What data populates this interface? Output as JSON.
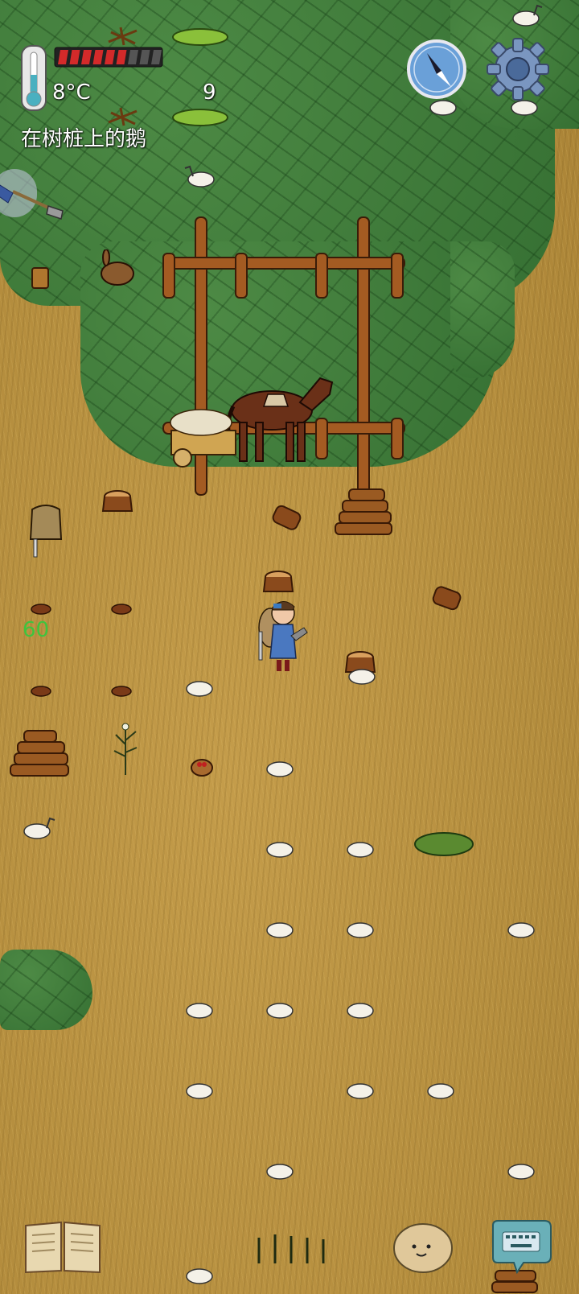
{
  "hud": {
    "temperature": "8°C",
    "hunger_count": "9",
    "hunger_pips_filled": 6,
    "hunger_pips_total": 9,
    "hover_label": "在树桩上的鹅",
    "age_indicator": "60"
  },
  "icons": {
    "thermometer": "thermometer-icon",
    "compass": "compass-icon",
    "settings": "gear-icon",
    "recipe_book": "book-icon",
    "emote": "potato-face-icon",
    "chat": "keyboard-chat-icon",
    "held_item": "shovel-icon"
  },
  "colors": {
    "hunger_filled": "#d42a2a",
    "hunger_empty": "#555555",
    "age_text": "#3ec43e",
    "compass_blue": "#6aa0d8"
  }
}
